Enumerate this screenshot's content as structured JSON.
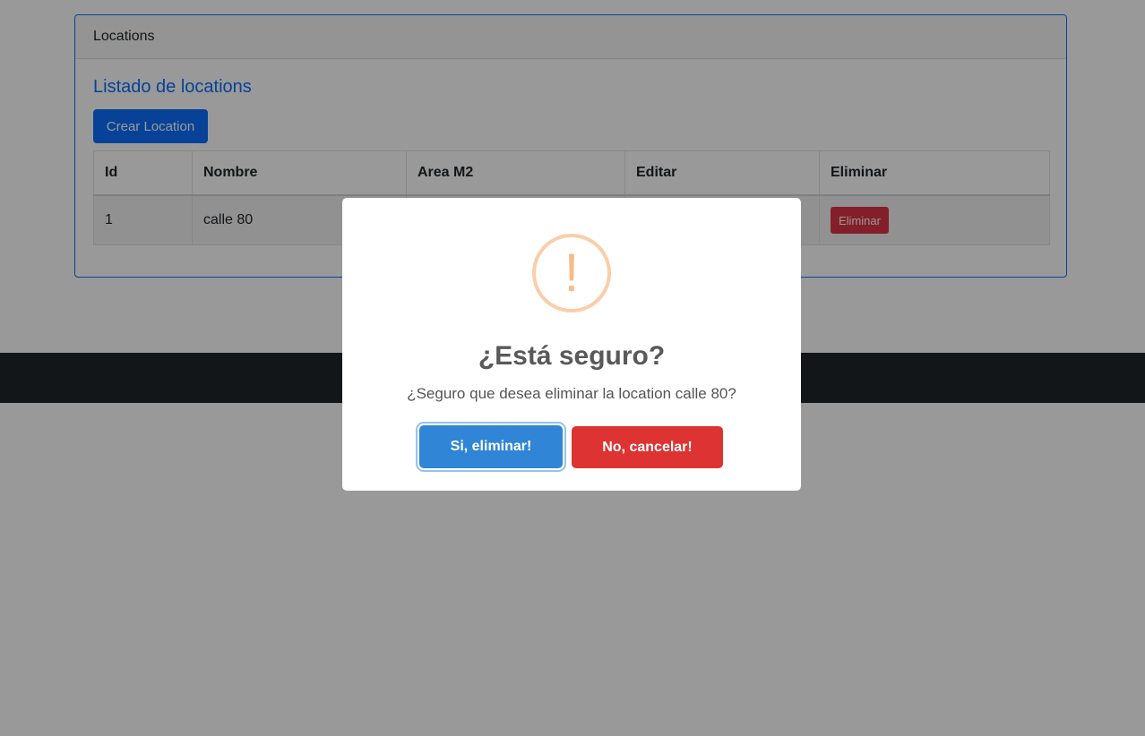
{
  "card": {
    "header": "Locations",
    "title": "Listado de locations",
    "create_button": "Crear Location"
  },
  "table": {
    "headers": [
      "Id",
      "Nombre",
      "Area M2",
      "Editar",
      "Eliminar"
    ],
    "rows": [
      {
        "id": "1",
        "nombre": "calle 80",
        "eliminar_label": "Eliminar"
      }
    ]
  },
  "dialog": {
    "icon": "warning-icon",
    "icon_symbol": "!",
    "icon_color": "#facea8",
    "title": "¿Está seguro?",
    "text": "¿Seguro que desea eliminar la location calle 80?",
    "confirm_label": "Si, eliminar!",
    "cancel_label": "No, cancelar!",
    "confirm_color": "#3085d6",
    "cancel_color": "#dd3333"
  }
}
